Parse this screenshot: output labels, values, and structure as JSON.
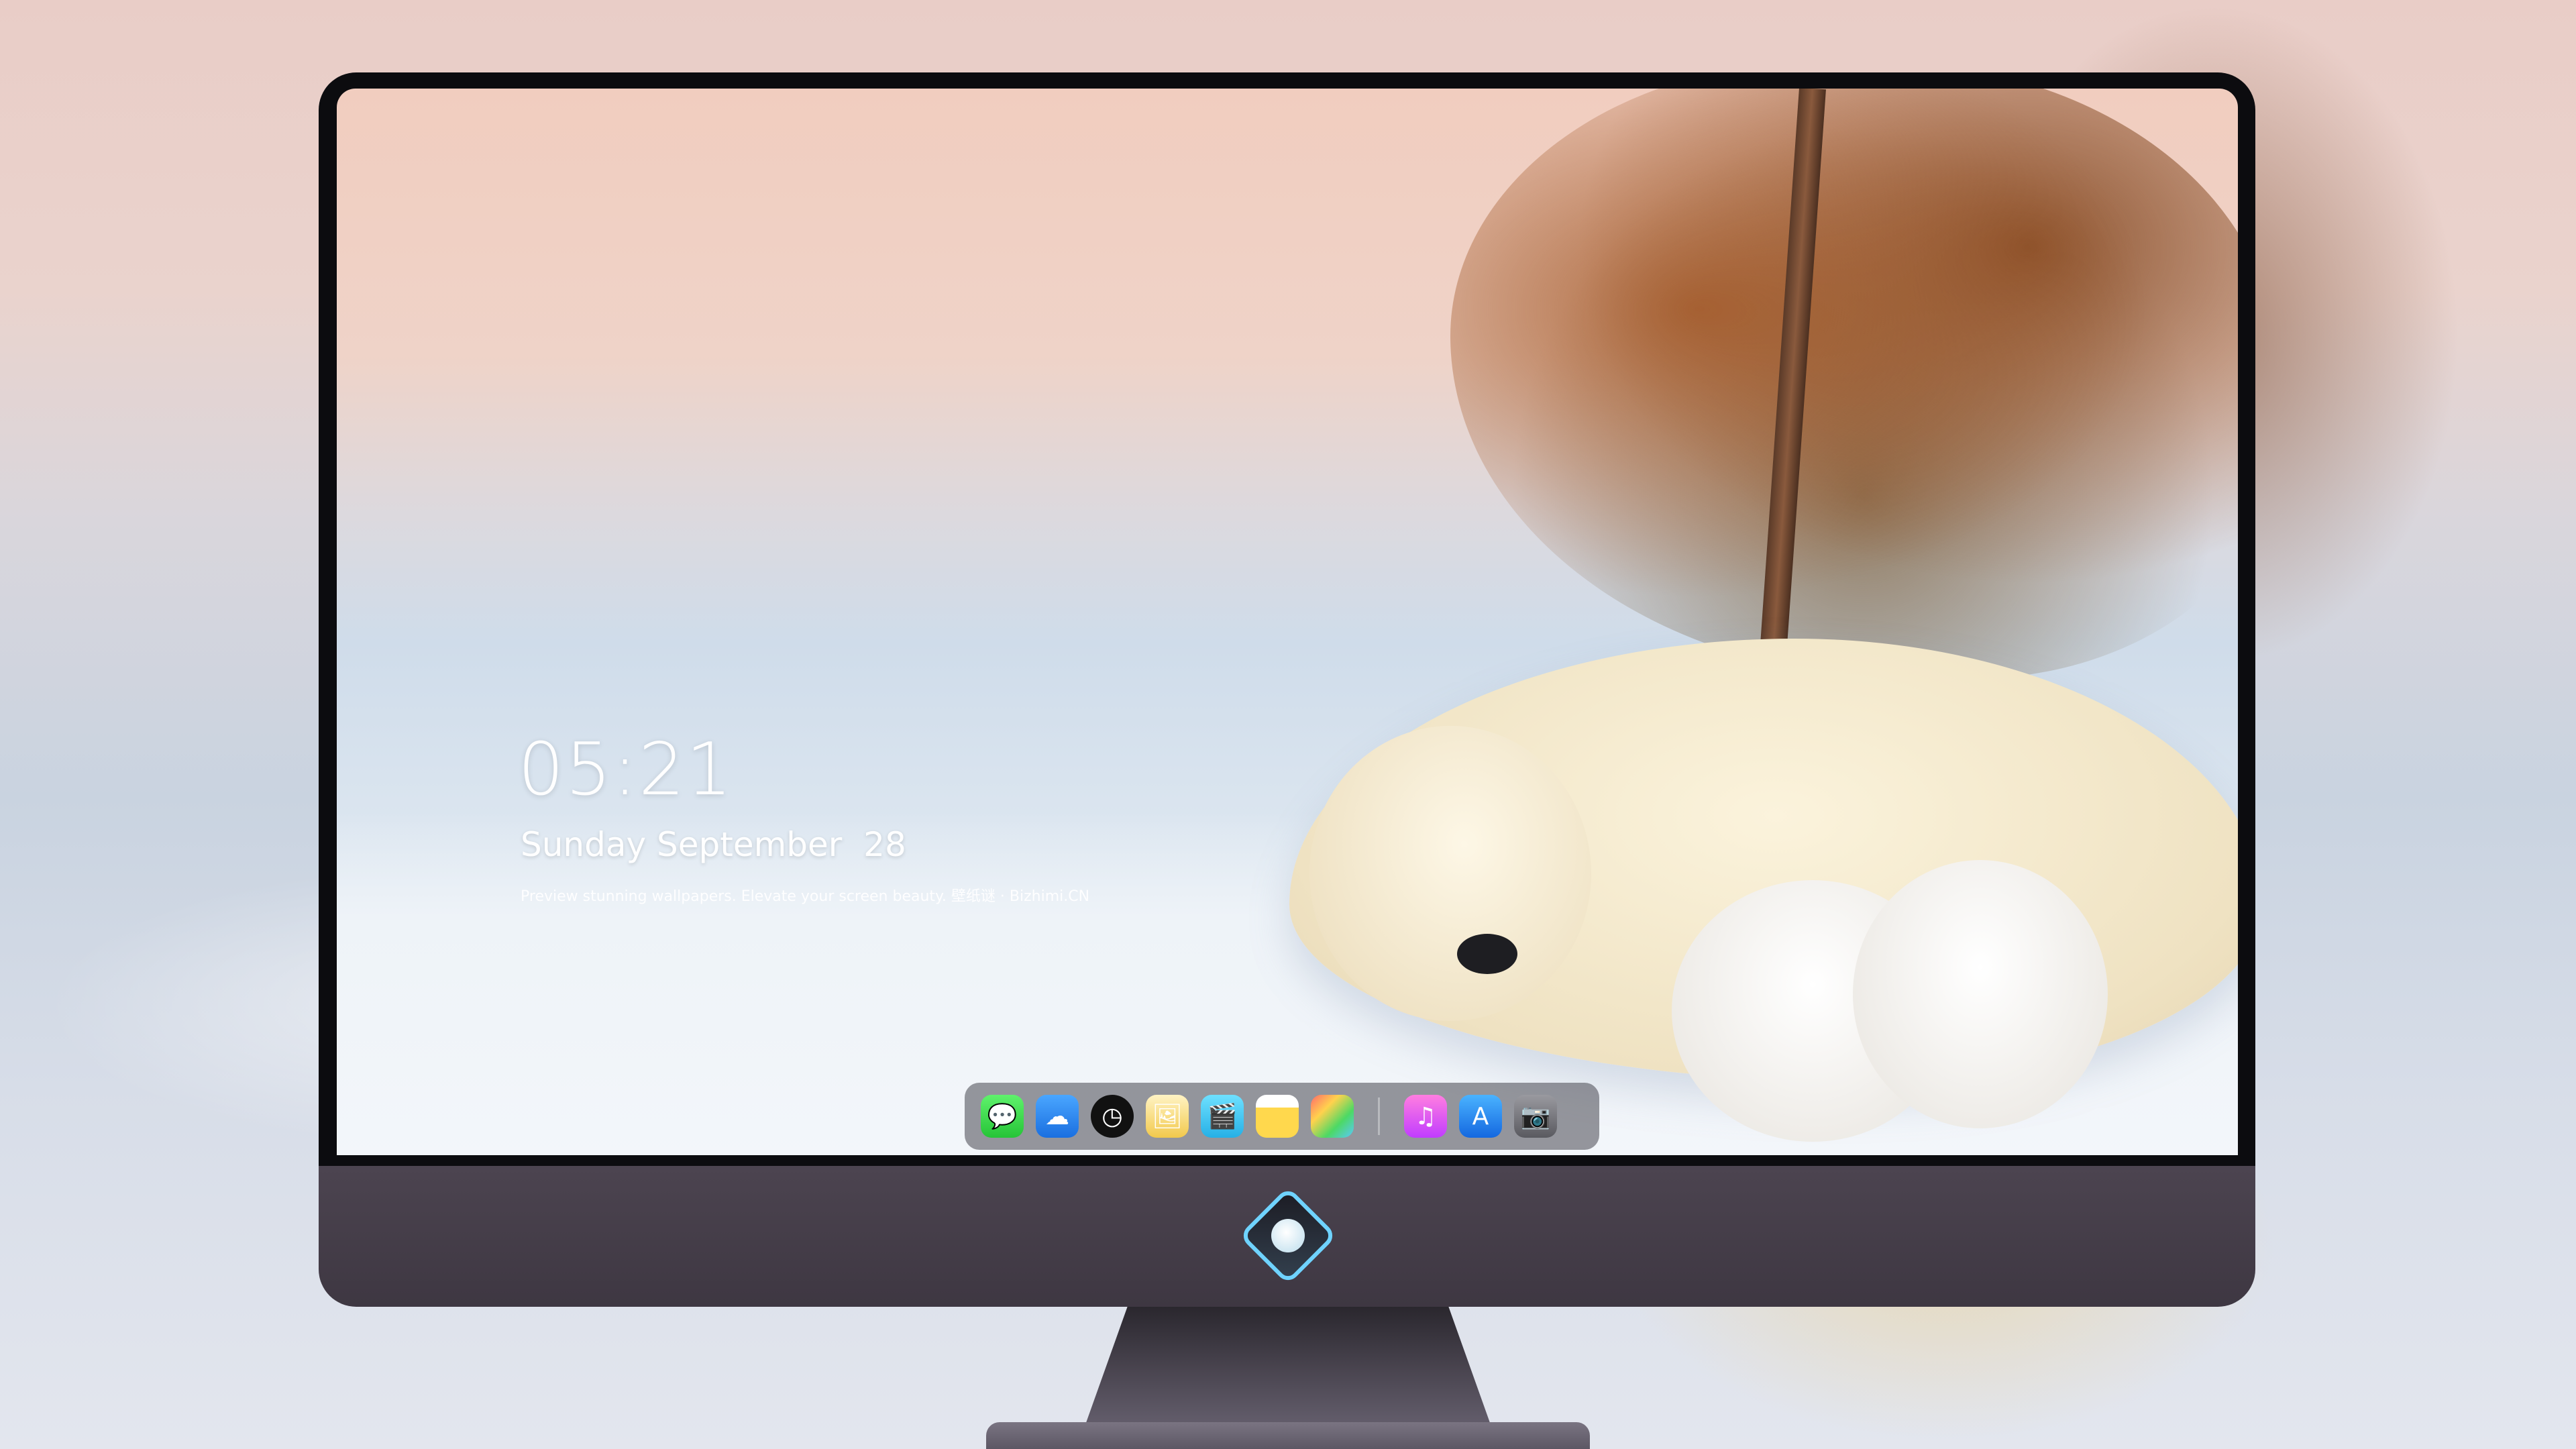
{
  "lockscreen": {
    "time": "05:21",
    "date": "Sunday September  28",
    "tagline": "Preview stunning wallpapers. Elevate your screen beauty. 壁纸谜 · Bizhimi.CN"
  },
  "dock": {
    "apps": [
      {
        "name": "messages-icon",
        "glyph": "💬"
      },
      {
        "name": "weather-icon",
        "glyph": "☁"
      },
      {
        "name": "clock-icon",
        "glyph": "◷"
      },
      {
        "name": "preview-icon",
        "glyph": "🖼"
      },
      {
        "name": "clapperboard-icon",
        "glyph": "🎬"
      },
      {
        "name": "notes-icon",
        "glyph": ""
      },
      {
        "name": "photos-icon",
        "glyph": ""
      },
      {
        "name": "music-icon",
        "glyph": "♫"
      },
      {
        "name": "app-store-icon",
        "glyph": "A"
      },
      {
        "name": "camera-icon",
        "glyph": "📷"
      }
    ]
  },
  "brand": {
    "accent": "#6fd3ff"
  }
}
